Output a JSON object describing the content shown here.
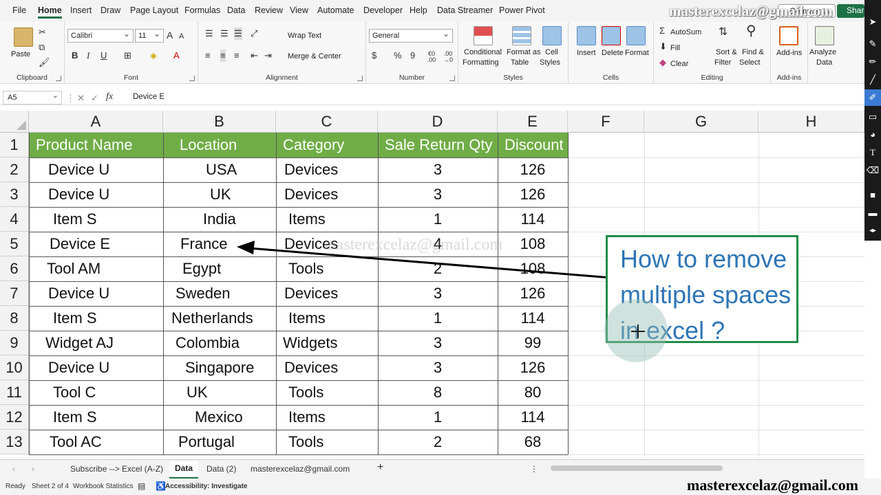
{
  "menu_tabs": [
    "File",
    "Home",
    "Insert",
    "Draw",
    "Page Layout",
    "Formulas",
    "Data",
    "Review",
    "View",
    "Automate",
    "Developer",
    "Help",
    "Data Streamer",
    "Power Pivot"
  ],
  "active_tab": "Home",
  "watermark_top": "masterexcelaz@gmail.com",
  "comments_label": "Comments",
  "share_label": "Share",
  "ribbon": {
    "clipboard": {
      "label": "Clipboard",
      "paste": "Paste"
    },
    "font": {
      "label": "Font",
      "name": "Calibri",
      "size": "11",
      "grow": "A",
      "shrink": "A",
      "bold": "B",
      "italic": "I",
      "underline": "U"
    },
    "alignment": {
      "label": "Alignment",
      "wrap": "Wrap Text",
      "merge": "Merge & Center"
    },
    "number": {
      "label": "Number",
      "format": "General",
      "currency": "$",
      "percent": "%",
      "comma": "9",
      "inc_dec": "€0 .00",
      "dec_dec": ".00 →0"
    },
    "styles": {
      "label": "Styles",
      "cond_l1": "Conditional",
      "cond_l2": "Formatting",
      "fmt_l1": "Format as",
      "fmt_l2": "Table",
      "cell_l1": "Cell",
      "cell_l2": "Styles"
    },
    "cells": {
      "label": "Cells",
      "insert": "Insert",
      "delete": "Delete",
      "format": "Format"
    },
    "editing": {
      "label": "Editing",
      "autosum": "AutoSum",
      "fill": "Fill",
      "clear": "Clear",
      "sort_l1": "Sort &",
      "sort_l2": "Filter",
      "find_l1": "Find &",
      "find_l2": "Select"
    },
    "addins": {
      "label": "Add-ins",
      "addins": "Add-ins",
      "analyze_l1": "Analyze",
      "analyze_l2": "Data"
    }
  },
  "formula_bar": {
    "name_box": "A5",
    "fx": "fx",
    "value": "Device E"
  },
  "columns": [
    "A",
    "B",
    "C",
    "D",
    "E",
    "F",
    "G",
    "H"
  ],
  "rows": [
    "1",
    "2",
    "3",
    "4",
    "5",
    "6",
    "7",
    "8",
    "9",
    "10",
    "11",
    "12",
    "13"
  ],
  "table": {
    "headers": [
      "Product Name",
      "Location",
      "Category",
      "Sale Return Qty",
      "Discount"
    ],
    "rows": [
      [
        "Device U",
        "USA",
        "Devices",
        "3",
        "126"
      ],
      [
        "Device U",
        "UK",
        "Devices",
        "3",
        "126"
      ],
      [
        "Item S",
        "India",
        "Items",
        "1",
        "114"
      ],
      [
        "Device E",
        "France",
        "Devices",
        "4",
        "108"
      ],
      [
        "Tool AM",
        "Egypt",
        "Tools",
        "2",
        "108"
      ],
      [
        "Device U",
        "Sweden",
        "Devices",
        "3",
        "126"
      ],
      [
        "Item S",
        "Netherlands",
        "Items",
        "1",
        "114"
      ],
      [
        "Widget AJ",
        "Colombia",
        "Widgets",
        "3",
        "99"
      ],
      [
        "Device U",
        "Singapore",
        "Devices",
        "3",
        "126"
      ],
      [
        "Tool C",
        "UK",
        "Tools",
        "8",
        "80"
      ],
      [
        "Item S",
        "Mexico",
        "Items",
        "1",
        "114"
      ],
      [
        "Tool AC",
        "Portugal",
        "Tools",
        "2",
        "68"
      ]
    ]
  },
  "callout_text": "How to remove multiple spaces in excel ?",
  "watermark_mid": "masterexcelaz@gmail.com",
  "sheet_tabs": [
    "Subscribe --> Excel (A-Z)",
    "Data",
    "Data (2)",
    "masterexcelaz@gmail.com"
  ],
  "active_sheet": "Data",
  "add_sheet": "+",
  "status": {
    "ready": "Ready",
    "sheet": "Sheet 2 of 4",
    "stats": "Workbook Statistics",
    "access": "Accessibility: Investigate"
  },
  "watermark_bottom": "masterexcelaz@gmail.com",
  "colors": {
    "header_green": "#70ad47",
    "callout_border": "#1e8c48",
    "callout_text": "#2e75b6",
    "accent": "#1e7145"
  }
}
